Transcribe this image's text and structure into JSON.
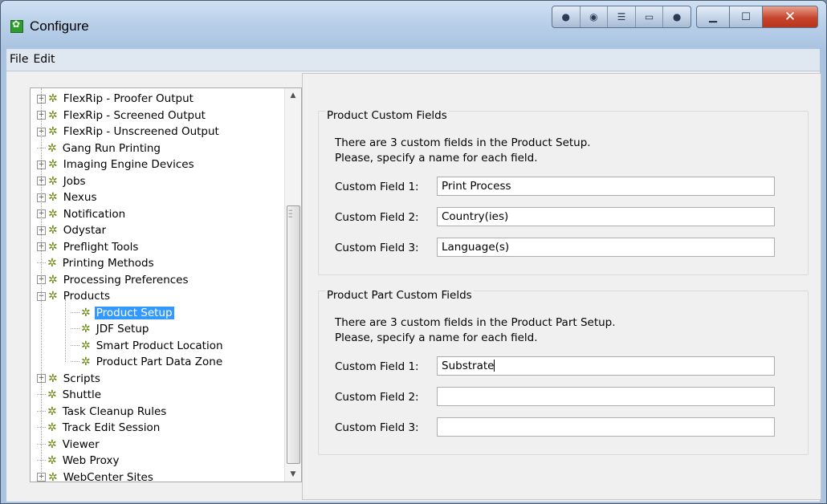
{
  "window": {
    "title": "Configure"
  },
  "menu": [
    "File",
    "Edit"
  ],
  "tree": {
    "items": [
      {
        "label": "FlexRip - Proofer Output",
        "expandable": true,
        "level": 0
      },
      {
        "label": "FlexRip - Screened Output",
        "expandable": true,
        "level": 0
      },
      {
        "label": "FlexRip - Unscreened Output",
        "expandable": true,
        "level": 0
      },
      {
        "label": "Gang Run Printing",
        "expandable": false,
        "level": 0
      },
      {
        "label": "Imaging Engine Devices",
        "expandable": true,
        "level": 0
      },
      {
        "label": "Jobs",
        "expandable": true,
        "level": 0
      },
      {
        "label": "Nexus",
        "expandable": true,
        "level": 0
      },
      {
        "label": "Notification",
        "expandable": true,
        "level": 0
      },
      {
        "label": "Odystar",
        "expandable": true,
        "level": 0
      },
      {
        "label": "Preflight Tools",
        "expandable": true,
        "level": 0
      },
      {
        "label": "Printing Methods",
        "expandable": false,
        "level": 0
      },
      {
        "label": "Processing Preferences",
        "expandable": true,
        "level": 0
      },
      {
        "label": "Products",
        "expandable": true,
        "expanded": true,
        "level": 0
      },
      {
        "label": "Product Setup",
        "expandable": false,
        "level": 1,
        "selected": true
      },
      {
        "label": "JDF Setup",
        "expandable": false,
        "level": 1
      },
      {
        "label": "Smart Product Location",
        "expandable": false,
        "level": 1
      },
      {
        "label": "Product Part Data Zone",
        "expandable": false,
        "level": 1
      },
      {
        "label": "Scripts",
        "expandable": true,
        "level": 0
      },
      {
        "label": "Shuttle",
        "expandable": false,
        "level": 0
      },
      {
        "label": "Task Cleanup Rules",
        "expandable": false,
        "level": 0
      },
      {
        "label": "Track Edit Session",
        "expandable": false,
        "level": 0
      },
      {
        "label": "Viewer",
        "expandable": false,
        "level": 0
      },
      {
        "label": "Web Proxy",
        "expandable": false,
        "level": 0
      },
      {
        "label": "WebCenter Sites",
        "expandable": true,
        "level": 0
      }
    ]
  },
  "product_custom_fields": {
    "title": "Product Custom Fields",
    "desc_line1": "There are 3 custom fields in the Product Setup.",
    "desc_line2": "Please, specify a name for each field.",
    "fields": [
      {
        "label": "Custom Field 1:",
        "value": "Print Process"
      },
      {
        "label": "Custom Field 2:",
        "value": "Country(ies)"
      },
      {
        "label": "Custom Field 3:",
        "value": "Language(s)"
      }
    ]
  },
  "product_part_custom_fields": {
    "title": "Product Part Custom Fields",
    "desc_line1": "There are 3 custom fields in the Product Part Setup.",
    "desc_line2": "Please, specify a name for each field.",
    "fields": [
      {
        "label": "Custom Field 1:",
        "value": "Substrate"
      },
      {
        "label": "Custom Field 2:",
        "value": ""
      },
      {
        "label": "Custom Field 3:",
        "value": ""
      }
    ]
  }
}
